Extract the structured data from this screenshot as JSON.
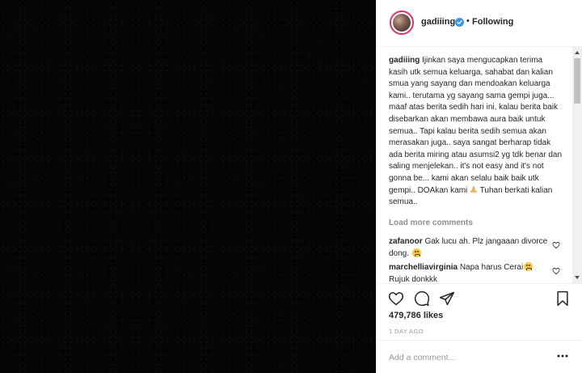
{
  "post": {
    "username": "gadiiing",
    "verified": true,
    "follow_separator": "•",
    "follow_status": "Following"
  },
  "caption": {
    "username": "gadiiing",
    "text_before_emoji": " Ijinkan saya mengucapkan terima kasih utk semua keluarga, sahabat dan kalian smua yang sayang dan mendoakan keluarga kami.. terutama yg sayang sama gempi juga... maaf atas berita sedih hari ini, kalau berita baik disebarkan akan membawa aura baik untuk semua.. Tapi kalau berita sedih semua akan merasakan juga.. saya sangat berharap tidak ada berita miring atau asumsi2 yg tdk benar dan saling menjelekan.. it's not easy and it's not gonna be... kami akan selalu baik baik utk gempi.. DOAkan kami ",
    "text_after_emoji": " Tuhan berkati kalian semua..",
    "emoji": "folded-hands"
  },
  "load_more_label": "Load more comments",
  "comments": [
    {
      "username": "zafanoor",
      "text": " Gak lucu ah. Plz jangaaan divorce dong. ",
      "emoji": "crying-face"
    },
    {
      "username": "marchelliavirginia",
      "text": " Napa harus Cerai",
      "text2": "Rujuk donkkk",
      "emoji": "crying-face"
    }
  ],
  "likes": "479,786 likes",
  "time_ago": "1 DAY AGO",
  "add_comment": {
    "placeholder": "Add a comment..."
  },
  "colors": {
    "media_bg": "#050505",
    "text": "#262626",
    "muted": "#8e8e8e",
    "verified": "#3897f0",
    "story_ring": "#e1306c"
  },
  "icons": [
    "verified-badge-icon",
    "heart-icon",
    "comment-bubble-icon",
    "share-icon",
    "bookmark-icon",
    "more-options-icon",
    "folded-hands-emoji",
    "crying-face-emoji"
  ]
}
